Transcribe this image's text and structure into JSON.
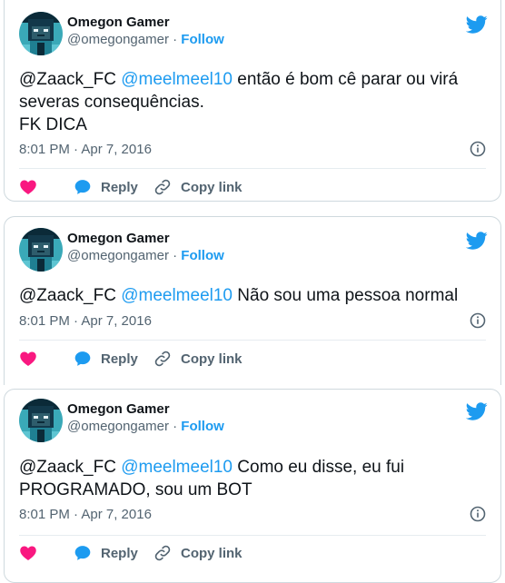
{
  "tweets": [
    {
      "display_name": "Omegon Gamer",
      "handle": "@omegongamer",
      "separator": "·",
      "follow_label": "Follow",
      "reply_to": "@Zaack_FC",
      "mention": "@meelmeel10",
      "text_line1": "então é bom cê parar ou virá",
      "text_line2": "severas consequências.",
      "text_line3": "FK DICA",
      "timestamp": "8:01 PM · Apr 7, 2016",
      "like_label": "",
      "reply_label": "Reply",
      "copy_label": "Copy link"
    },
    {
      "display_name": "Omegon Gamer",
      "handle": "@omegongamer",
      "separator": "·",
      "follow_label": "Follow",
      "reply_to": "@Zaack_FC",
      "mention": "@meelmeel10",
      "text_line1": "Não sou uma pessoa normal",
      "timestamp": "8:01 PM · Apr 7, 2016",
      "like_label": "",
      "reply_label": "Reply",
      "copy_label": "Copy link"
    },
    {
      "display_name": "Omegon Gamer",
      "handle": "@omegongamer",
      "separator": "·",
      "follow_label": "Follow",
      "reply_to": "@Zaack_FC",
      "mention": "@meelmeel10",
      "text_line1": "Como eu disse, eu fui",
      "text_line2": "PROGRAMADO, sou um BOT",
      "timestamp": "8:01 PM · Apr 7, 2016",
      "like_label": "",
      "reply_label": "Reply",
      "copy_label": "Copy link"
    }
  ],
  "colors": {
    "accent": "#1d9bf0",
    "like": "#f91880",
    "secondary_text": "#536471",
    "border": "#cfd9de"
  },
  "icons": {
    "brand": "twitter-bird-icon",
    "info": "info-icon",
    "like": "heart-icon",
    "reply": "speech-bubble-icon",
    "copy": "link-icon"
  }
}
